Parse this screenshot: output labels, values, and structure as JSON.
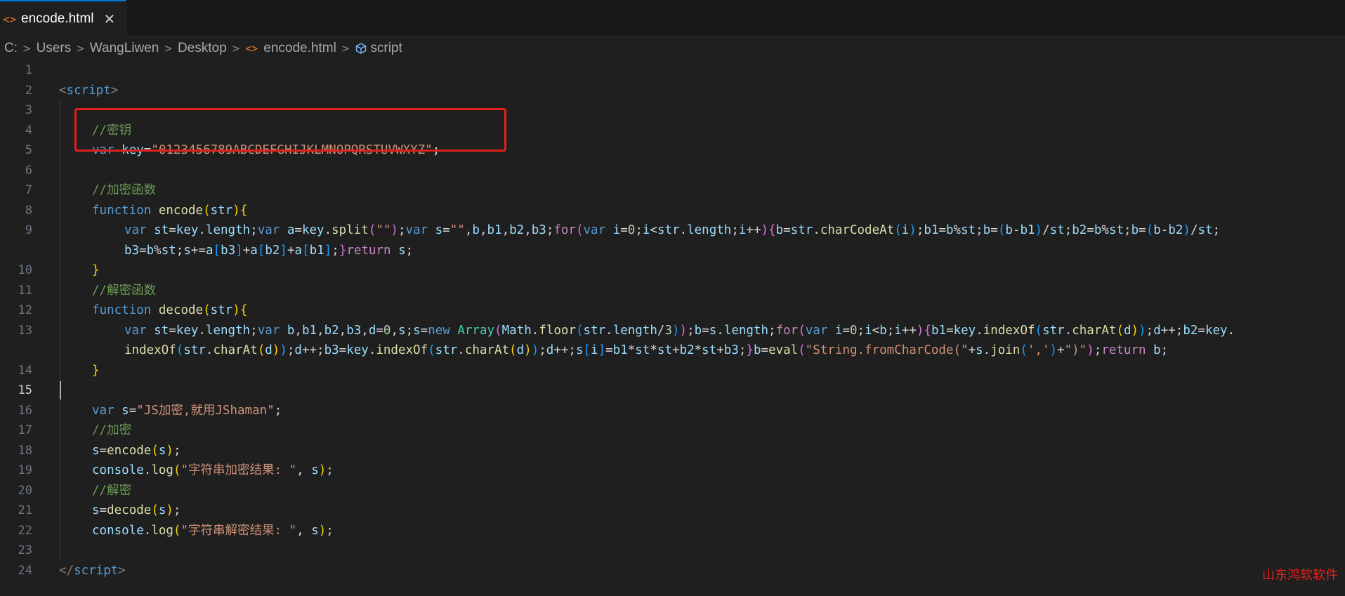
{
  "tab": {
    "title": "encode.html",
    "close": "✕"
  },
  "breadcrumb": {
    "drive": "C:",
    "users": "Users",
    "user": "WangLiwen",
    "folder": "Desktop",
    "file": "encode.html",
    "symbol": "script"
  },
  "editor": {
    "line_numbers": [
      "1",
      "2",
      "3",
      "4",
      "5",
      "6",
      "7",
      "8",
      "9",
      "10",
      "11",
      "12",
      "13",
      "14",
      "15",
      "16",
      "17",
      "18",
      "19",
      "20",
      "21",
      "22",
      "23",
      "24"
    ],
    "active_line": "15"
  },
  "code": {
    "script_open": "script",
    "comment_key": "//密钥",
    "key_value": "\"0123456789ABCDEFGHIJKLMNOPQRSTUVWXYZ\"",
    "comment_encode": "//加密函数",
    "fn_encode": "encode",
    "comment_decode": "//解密函数",
    "fn_decode": "decode",
    "var_s_value": "\"JS加密,就用JShaman\"",
    "comment_enc": "//加密",
    "log_enc_str": "\"字符串加密结果: \"",
    "comment_dec": "//解密",
    "log_dec_str": "\"字符串解密结果: \"",
    "script_close": "script"
  },
  "watermark": "山东鸿软软件",
  "colors": {
    "accent": "#0078d4",
    "highlight_box": "#e0211b"
  }
}
